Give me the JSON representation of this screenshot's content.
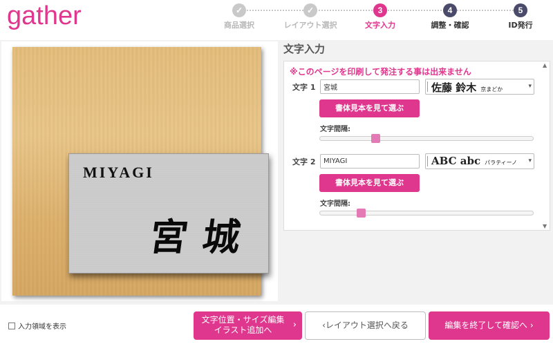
{
  "header": {
    "logo": "gather",
    "steps": [
      {
        "num": "✓",
        "label": "商品選択",
        "state": "done"
      },
      {
        "num": "✓",
        "label": "レイアウト選択",
        "state": "done"
      },
      {
        "num": "3",
        "label": "文字入力",
        "state": "current"
      },
      {
        "num": "4",
        "label": "調整・確認",
        "state": "todo"
      },
      {
        "num": "5",
        "label": "ID発行",
        "state": "todo"
      }
    ]
  },
  "preview": {
    "english_text": "MIYAGI",
    "japanese_text": "宮城"
  },
  "form": {
    "title": "文字入力",
    "warning": "※このページを印刷して発注する事は出来ません",
    "fields": [
      {
        "label": "文字 1",
        "value": "宮城",
        "font_sample": "佐藤 鈴木",
        "font_name": "京まどか",
        "font_button": "書体見本を見て選ぶ",
        "spacing_label": "文字間隔:",
        "spacing_value": 0.25
      },
      {
        "label": "文字 2",
        "value": "MIYAGI",
        "font_sample": "ABC abc",
        "font_name": "パラティーノ",
        "font_button": "書体見本を見て選ぶ",
        "spacing_label": "文字間隔:",
        "spacing_value": 0.18
      }
    ]
  },
  "footer": {
    "show_input_area_label": "入力領域を表示",
    "edit_position_label_1": "文字位置・サイズ編集",
    "edit_position_label_2": "イラスト追加へ",
    "back_label": "レイアウト選択へ戻る",
    "finish_label": "編集を終了して確認へ"
  },
  "colors": {
    "accent": "#e0378e",
    "step_done": "#c9c9c9",
    "step_todo": "#4a4a6a"
  }
}
